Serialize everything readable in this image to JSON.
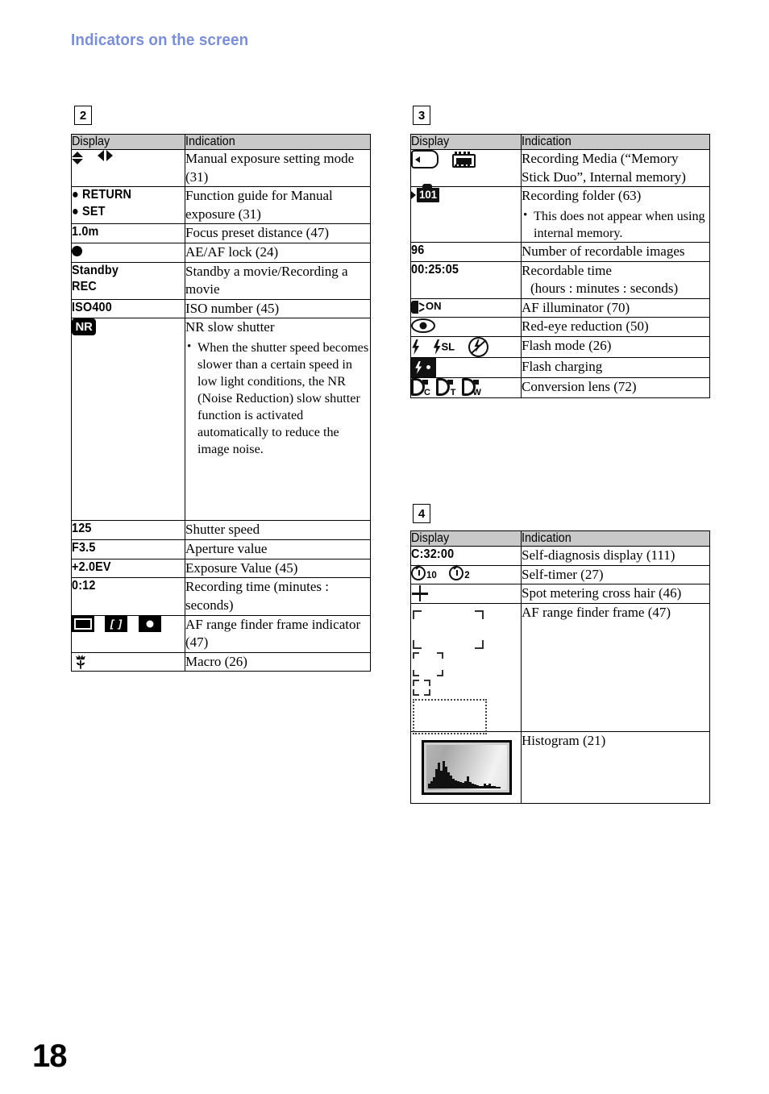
{
  "header": {
    "title": "Indicators on the screen"
  },
  "page_number": "18",
  "columns": {
    "display": "Display",
    "indication": "Indication"
  },
  "sections": [
    {
      "badge": "2",
      "rows": [
        {
          "display_icons": [
            "up-down-arrows-icon",
            "left-right-arrows-icon"
          ],
          "indication": "Manual exposure setting mode (31)"
        },
        {
          "display_text_lines": [
            "● RETURN",
            "● SET"
          ],
          "indication": "Function guide for Manual exposure (31)"
        },
        {
          "display_text": "1.0m",
          "indication": "Focus preset distance (47)"
        },
        {
          "display_icons": [
            "filled-circle-icon"
          ],
          "indication": "AE/AF lock (24)"
        },
        {
          "display_text_lines": [
            "Standby",
            "REC"
          ],
          "indication": "Standby a movie/Recording a movie"
        },
        {
          "display_text": "ISO400",
          "indication": "ISO number (45)"
        },
        {
          "display_icons": [
            "nr-badge-icon"
          ],
          "indication": "NR slow shutter",
          "bullets": [
            "When the shutter speed becomes slower than a certain speed in low light conditions, the NR (Noise Reduction) slow shutter function is activated automatically to reduce the image noise."
          ]
        },
        {
          "display_text": "125",
          "indication": "Shutter speed"
        },
        {
          "display_text": "F3.5",
          "indication": "Aperture value"
        },
        {
          "display_text": "+2.0EV",
          "indication": "Exposure Value (45)"
        },
        {
          "display_text": "0:12",
          "indication": "Recording time (minutes : seconds)"
        },
        {
          "display_icons": [
            "af-frame-dashed-badge-icon",
            "af-frame-brackets-badge-icon",
            "af-frame-dot-badge-icon"
          ],
          "indication": "AF range finder frame indicator (47)"
        },
        {
          "display_icons": [
            "macro-tulip-icon"
          ],
          "indication": "Macro (26)"
        }
      ]
    },
    {
      "badge": "3",
      "rows": [
        {
          "display_icons": [
            "memory-stick-icon",
            "internal-memory-chip-icon"
          ],
          "indication": "Recording Media (“Memory Stick Duo”, Internal memory)"
        },
        {
          "display_icons": [
            "recording-folder-101-icon"
          ],
          "indication": "Recording folder (63)",
          "bullets": [
            "This does not appear when using internal memory."
          ]
        },
        {
          "display_text": "96",
          "indication": "Number of recordable images"
        },
        {
          "display_text": "00:25:05",
          "indication": "Recordable time",
          "indication_indent": "(hours : minutes : seconds)"
        },
        {
          "display_icons": [
            "af-illuminator-on-icon"
          ],
          "indication": "AF illuminator (70)"
        },
        {
          "display_icons": [
            "red-eye-icon"
          ],
          "indication": "Red-eye reduction (50)"
        },
        {
          "display_icons": [
            "flash-on-icon",
            "flash-slow-sync-icon",
            "flash-off-icon"
          ],
          "indication": "Flash mode (26)"
        },
        {
          "display_icons": [
            "flash-charging-icon"
          ],
          "indication": "Flash charging"
        },
        {
          "display_icons": [
            "conversion-lens-c-icon",
            "conversion-lens-t-icon",
            "conversion-lens-w-icon"
          ],
          "indication": "Conversion lens (72)"
        }
      ]
    },
    {
      "badge": "4",
      "rows": [
        {
          "display_text": "C:32:00",
          "indication": "Self-diagnosis display (111)"
        },
        {
          "display_icons": [
            "self-timer-10-icon",
            "self-timer-2-icon"
          ],
          "indication": "Self-timer (27)"
        },
        {
          "display_icons": [
            "spot-metering-cross-icon"
          ],
          "indication": "Spot metering cross hair (46)"
        },
        {
          "display_icons": [
            "af-range-finder-frames-illustration"
          ],
          "indication": "AF range finder frame (47)"
        },
        {
          "display_icons": [
            "histogram-thumbnail-icon"
          ],
          "indication": "Histogram (21)"
        }
      ]
    }
  ],
  "conversion_lens_subscripts": [
    "C",
    "T",
    "W"
  ],
  "self_timer_subscripts": [
    "10",
    "2"
  ],
  "folder_number": "101",
  "af_illuminator_label": "ON",
  "flash_slow_label": "SL",
  "nr_label": "NR"
}
